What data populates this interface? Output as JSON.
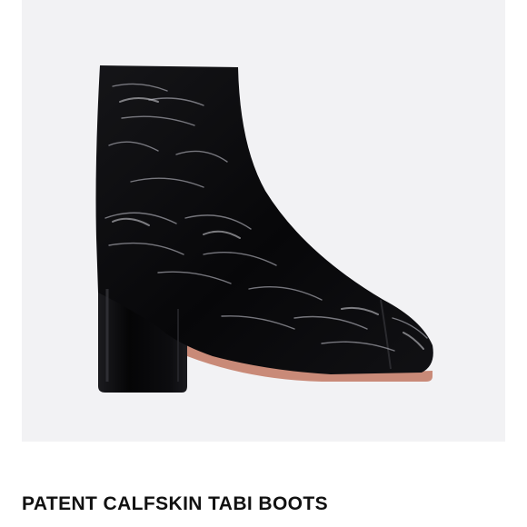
{
  "product": {
    "title": "PATENT CALFSKIN TABI BOOTS",
    "image_description_icon": "boot-image",
    "colors": {
      "background": "#f2f2f4",
      "boot": "#0b0b0d",
      "sole": "#c98a78",
      "title": "#111111"
    }
  }
}
